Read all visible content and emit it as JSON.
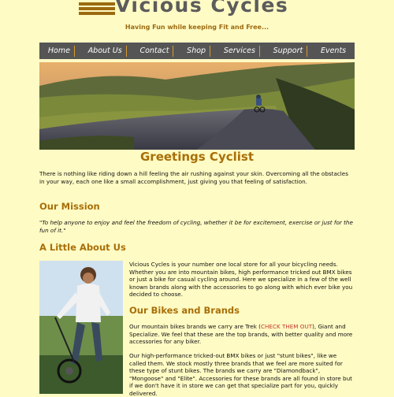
{
  "header": {
    "site_name": "Vicious Cycles",
    "tagline": "Having Fun while keeping Fit and Free..."
  },
  "nav": {
    "items": [
      "Home",
      "About Us",
      "Contact",
      "Shop",
      "Services",
      "Support",
      "Events"
    ]
  },
  "main": {
    "greeting": "Greetings Cyclist",
    "intro": "There is nothing like riding down a hill feeling the air rushing against your skin. Overcoming all the obstacles in your way, each one like a small accomplishment, just giving you that feeling of satisfaction.",
    "mission_heading": "Our Mission",
    "mission_text": "\"To help anyone to enjoy and feel the freedom of cycling, whether it be for excitement, exercise or just for the fun of it.\"",
    "about_heading": "A Little About Us",
    "about_text": "Vicious Cycles is your number one local store for all your bicycling needs. Whether you are into mountain bikes, high performance tricked out BMX bikes or just a bike for casual cycling around. Here we specialize in a few of the well known brands along with the accessories to go along with which ever bike you decided to choose.",
    "bikes_heading": "Our Bikes and Brands",
    "bikes_text_a": "Our mountain bikes brands we carry are Trek (",
    "bikes_link": "CHECK THEM OUT",
    "bikes_text_b": "), Giant and Specialize. We feel that these are the top brands, with better quality and more accessories for any biker.",
    "bmx_text": "Our high-performance tricked-out BMX bikes or just \"stunt bikes\", like we called them. We stock mostly three brands that we feel are more suited for these type of stunt bikes. The brands we carry are \"Diamondback\", \"Mongoose\" and \"Elite\". Accessories for these brands are all found in store but if we don't have it in store we can get that specialize part for you, quickly delivered."
  },
  "colors": {
    "background": "#fffbc4",
    "accent": "#a86f08",
    "nav_bg": "#555555",
    "link": "#c0392b"
  }
}
